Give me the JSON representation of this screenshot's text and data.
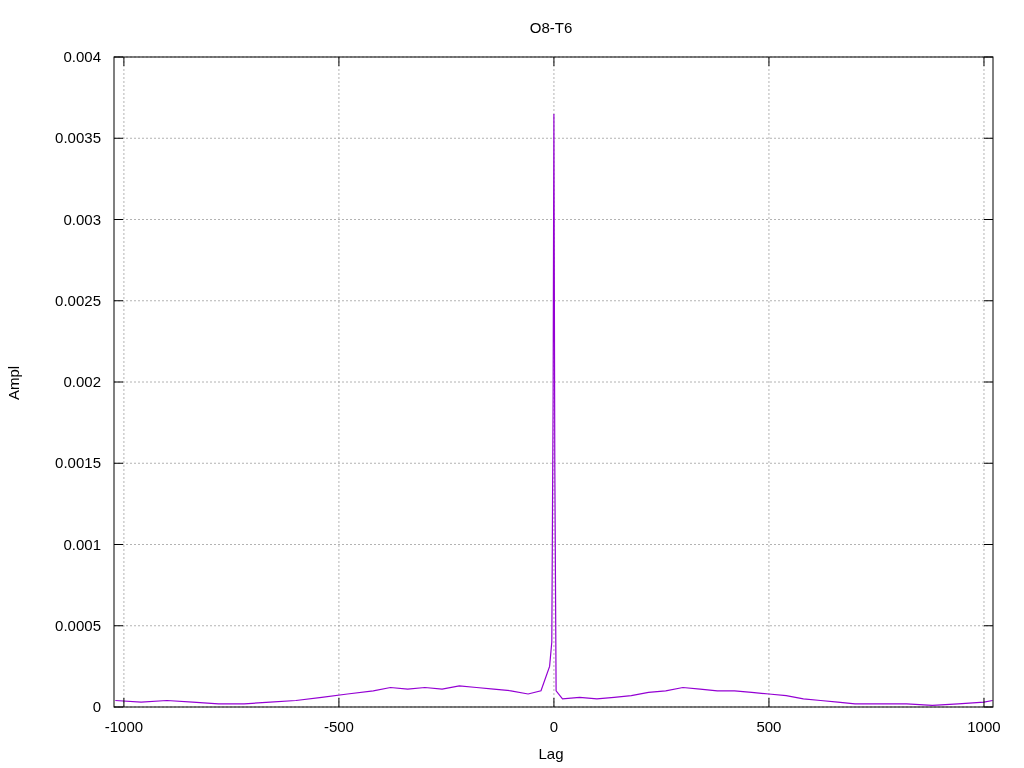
{
  "chart_data": {
    "type": "line",
    "title": "O8-T6",
    "xlabel": "Lag",
    "ylabel": "Ampl",
    "xlim": [
      -1023,
      1021
    ],
    "grid": true,
    "ylim": [
      0,
      0.004
    ],
    "xticks": [
      -1000,
      -500,
      0,
      500,
      1000
    ],
    "yticks": [
      0,
      {
        "value": 0.0005,
        "label": "0.0005"
      },
      {
        "value": 0.001,
        "label": "0.001"
      },
      {
        "value": 0.0015,
        "label": "0.0015"
      },
      {
        "value": 0.002,
        "label": "0.002"
      },
      {
        "value": 0.0025,
        "label": "0.0025"
      },
      {
        "value": 0.003,
        "label": "0.003"
      },
      {
        "value": 0.0035,
        "label": "0.0035"
      },
      {
        "value": 0.004,
        "label": "0.004"
      }
    ],
    "x": [
      -1020,
      -960,
      -900,
      -840,
      -780,
      -720,
      -660,
      -600,
      -540,
      -480,
      -420,
      -380,
      -340,
      -300,
      -260,
      -220,
      -180,
      -140,
      -100,
      -60,
      -30,
      -10,
      -5,
      -2,
      0,
      2,
      5,
      20,
      60,
      100,
      140,
      180,
      220,
      260,
      300,
      340,
      380,
      420,
      460,
      500,
      540,
      580,
      620,
      660,
      700,
      760,
      820,
      880,
      940,
      1000,
      1020
    ],
    "series": [
      {
        "color": "#9400d3",
        "values": [
          4e-05,
          3e-05,
          4e-05,
          3e-05,
          2e-05,
          2e-05,
          3e-05,
          4e-05,
          6e-05,
          8e-05,
          0.0001,
          0.00012,
          0.00011,
          0.00012,
          0.00011,
          0.00013,
          0.00012,
          0.00011,
          0.0001,
          8e-05,
          0.0001,
          0.00025,
          0.0004,
          0.0019,
          0.00365,
          0.0015,
          0.0001,
          5e-05,
          6e-05,
          5e-05,
          6e-05,
          7e-05,
          9e-05,
          0.0001,
          0.00012,
          0.00011,
          0.0001,
          0.0001,
          9e-05,
          8e-05,
          7e-05,
          5e-05,
          4e-05,
          3e-05,
          2e-05,
          2e-05,
          2e-05,
          1e-05,
          2e-05,
          3e-05,
          4e-05
        ]
      }
    ]
  }
}
